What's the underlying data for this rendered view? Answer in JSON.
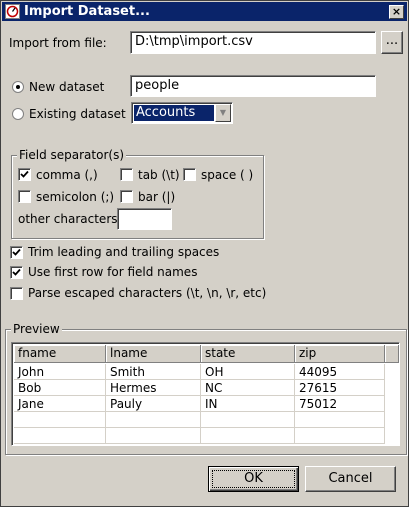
{
  "window": {
    "title": "Import Dataset...",
    "close_label": "×",
    "icon": "app-icon"
  },
  "import_file": {
    "label": "Import from file:",
    "value": "D:\\tmp\\import.csv",
    "browse_label": "..."
  },
  "new_dataset": {
    "label": "New dataset",
    "value": "people",
    "selected": true
  },
  "existing_dataset": {
    "label": "Existing dataset",
    "value": "Accounts",
    "selected": false
  },
  "separators": {
    "title": "Field separator(s)",
    "comma": {
      "label": "comma (,)",
      "checked": true
    },
    "tab": {
      "label": "tab (\\t)",
      "checked": false
    },
    "space": {
      "label": "space ( )",
      "checked": false
    },
    "semicolon": {
      "label": "semicolon (;)",
      "checked": false
    },
    "bar": {
      "label": "bar (|)",
      "checked": false
    },
    "other_label": "other characters:",
    "other_value": ""
  },
  "options": {
    "trim": {
      "label": "Trim leading and trailing spaces",
      "checked": true
    },
    "first_row": {
      "label": "Use first row for field names",
      "checked": true
    },
    "escaped": {
      "label": "Parse escaped characters (\\t, \\n, \\r, etc)",
      "checked": false
    }
  },
  "preview": {
    "title": "Preview",
    "columns": [
      "fname",
      "lname",
      "state",
      "zip"
    ],
    "rows": [
      [
        "John",
        "Smith",
        "OH",
        "44095"
      ],
      [
        "Bob",
        "Hermes",
        "NC",
        "27615"
      ],
      [
        "Jane",
        "Pauly",
        "IN",
        "75012"
      ]
    ]
  },
  "buttons": {
    "ok": "OK",
    "cancel": "Cancel"
  },
  "colors": {
    "titlebar": "#0a246a",
    "face": "#d4d0c8",
    "selection": "#0a246a"
  }
}
